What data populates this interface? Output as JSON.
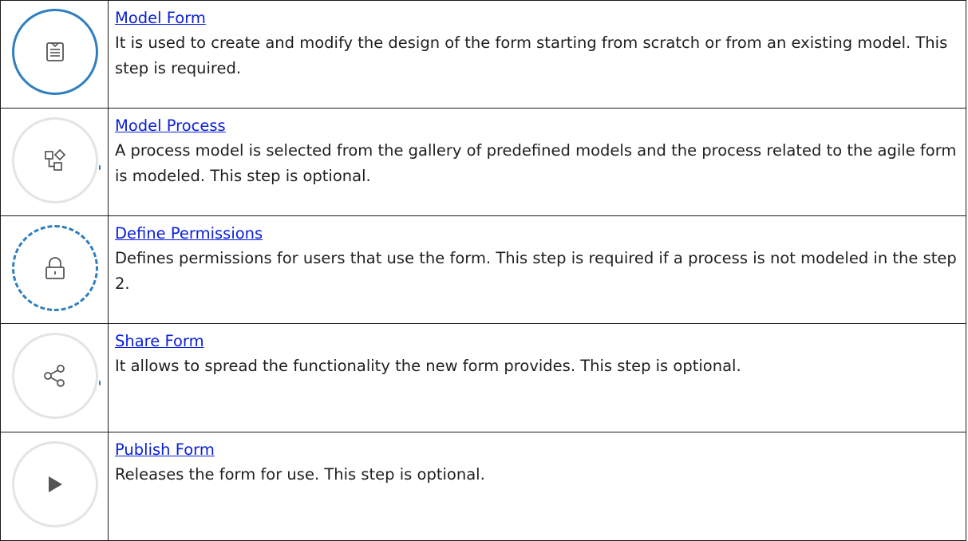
{
  "colors": {
    "link": "#0b20d8",
    "accent_ring": "#2f7fc0",
    "inactive_ring": "#e4e4e4",
    "icon": "#555555"
  },
  "steps": [
    {
      "link": "Model Form",
      "description": "It is used to create and modify the design of the form starting from scratch or from an existing model. This step is required.",
      "icon": "form-icon",
      "ring": "solid-accent"
    },
    {
      "link": "Model Process",
      "description": "A process model is selected from the gallery of predefined models and the process related to the agile form is modeled. This step is optional.",
      "icon": "process-shapes-icon",
      "ring": "grey"
    },
    {
      "link": "Define Permissions",
      "description": "Defines permissions for users that use the form. This step is required if a process is not modeled in the step 2.",
      "icon": "lock-icon",
      "ring": "dashed-accent"
    },
    {
      "link": "Share Form",
      "description": "It allows to spread the functionality the new form provides. This step is optional.",
      "icon": "share-icon",
      "ring": "grey"
    },
    {
      "link": "Publish Form",
      "description": "Releases the form for use. This step is optional.",
      "icon": "play-icon",
      "ring": "grey"
    }
  ]
}
